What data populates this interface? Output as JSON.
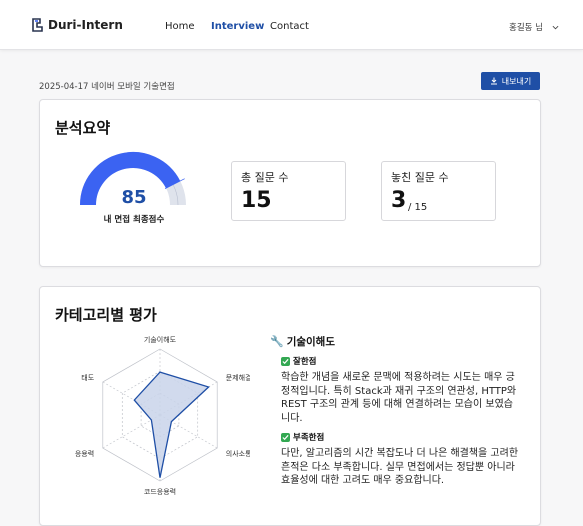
{
  "header": {
    "app_name": "Duri-Intern",
    "nav": [
      "Home",
      "Interview",
      "Contact"
    ],
    "active_nav": "Interview",
    "user_label": "홍길동 님"
  },
  "page": {
    "meta": "2025-04-17 네이버 모바일 기술면접",
    "export_label": "내보내기"
  },
  "summary": {
    "title": "분석요약",
    "score": "85",
    "score_fraction": 0.85,
    "score_label": "내 면접 최종점수",
    "total_label": "총 질문 수",
    "total_value": "15",
    "missed_label": "놓친 질문 수",
    "missed_value": "3",
    "missed_of": "/ 15"
  },
  "category": {
    "title": "카테고리별 평가",
    "axes": [
      "기술이해도",
      "문제해결력",
      "의사소통능력",
      "코드응용력",
      "응용력",
      "태도"
    ],
    "values": [
      0.65,
      0.85,
      0.2,
      0.95,
      0.15,
      0.45
    ],
    "detail_title": "기술이해도",
    "good_label": "잘한점",
    "good_text": "학습한 개념을 새로운 문맥에 적용하려는 시도는 매우 긍정적입니다. 특히 Stack과 재귀 구조의 연관성, HTTP와 REST 구조의 관계 등에 대해 연결하려는 모습이 보였습니다.",
    "bad_label": "부족한점",
    "bad_text": "다만, 알고리즘의 시간 복잡도나 더 나은 해결책을 고려한 흔적은 다소 부족합니다. 실무 면접에서는 정답뿐 아니라 효율성에 대한 고려도 매우 중요합니다."
  },
  "colors": {
    "accent": "#1f4fa6",
    "gauge_fill": "#3b63f2",
    "radar_fill": "#c9d4ea",
    "radar_stroke": "#1f4fa6"
  }
}
